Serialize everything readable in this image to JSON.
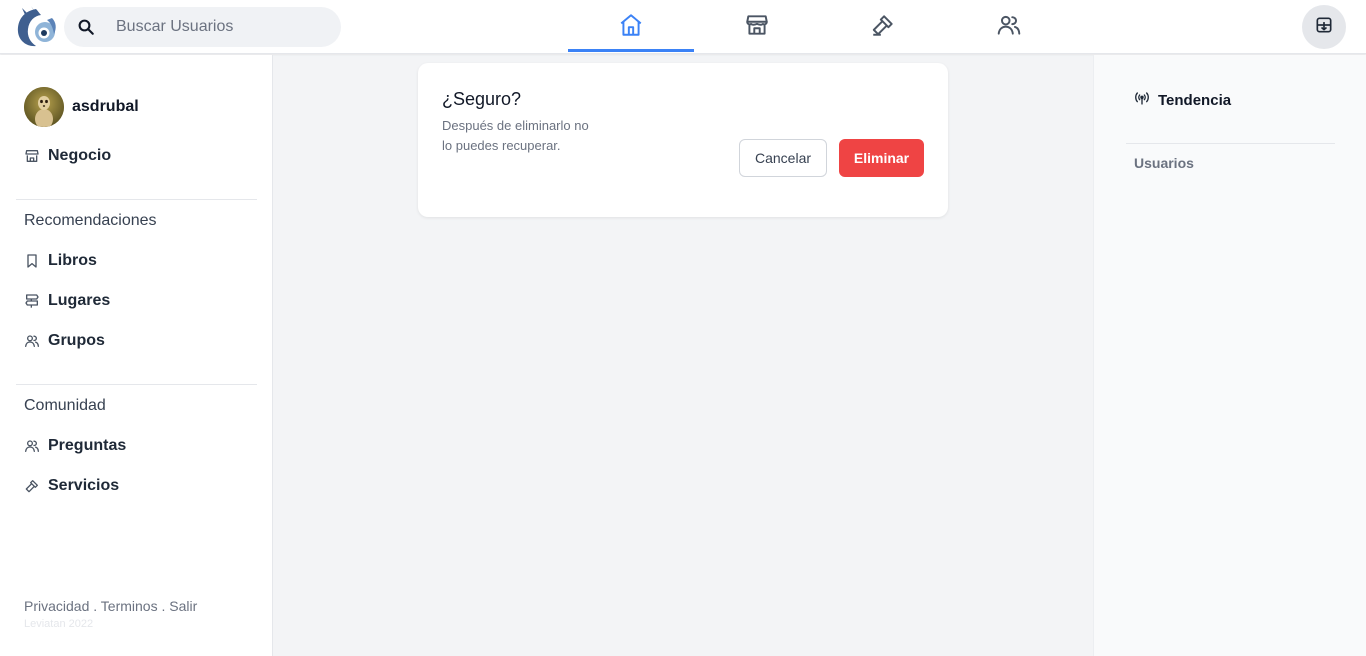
{
  "header": {
    "search_placeholder": "Buscar Usuarios",
    "tabs": [
      {
        "icon": "home-icon",
        "active": true
      },
      {
        "icon": "store-icon",
        "active": false
      },
      {
        "icon": "hammer-icon",
        "active": false
      },
      {
        "icon": "users-icon",
        "active": false
      }
    ],
    "accent_color": "#3b82f6"
  },
  "sidebar": {
    "username": "asdrubal",
    "business_label": "Negocio",
    "recommendations_title": "Recomendaciones",
    "recommendations": [
      {
        "label": "Libros",
        "icon": "bookmark-icon"
      },
      {
        "label": "Lugares",
        "icon": "signpost-icon"
      },
      {
        "label": "Grupos",
        "icon": "users-icon"
      }
    ],
    "community_title": "Comunidad",
    "community": [
      {
        "label": "Preguntas",
        "icon": "users-icon"
      },
      {
        "label": "Servicios",
        "icon": "hammer-icon"
      }
    ],
    "footer": {
      "privacy": "Privacidad",
      "terms": "Terminos",
      "logout": "Salir",
      "separator": " . ",
      "copyright": "Leviatan 2022"
    }
  },
  "dialog": {
    "title": "¿Seguro?",
    "message": "Después de eliminarlo no lo puedes recuperar.",
    "cancel_label": "Cancelar",
    "delete_label": "Eliminar",
    "delete_color": "#ef4444"
  },
  "right_sidebar": {
    "trending_label": "Tendencia",
    "users_label": "Usuarios"
  }
}
